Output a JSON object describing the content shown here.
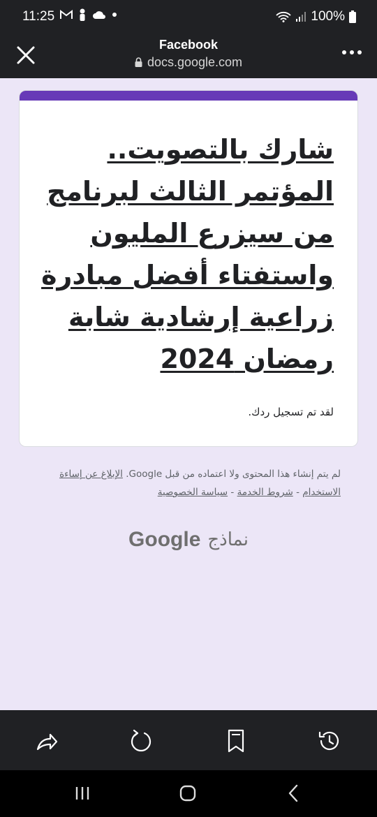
{
  "status_bar": {
    "time": "11:25",
    "battery": "100%",
    "notif_icons": [
      "gmail-icon",
      "person-icon",
      "cloud-icon",
      "dot-icon"
    ],
    "right_icons": [
      "wifi-icon",
      "signal-icon",
      "battery-icon"
    ]
  },
  "browser": {
    "title": "Facebook",
    "url": "docs.google.com"
  },
  "form": {
    "accent_color": "#673ab7",
    "title": "شارك بالتصويت.. المؤتمر الثالث لبرنامج من سيزرع المليون واستفتاء أفضل مبادرة زراعية إرشادية شابة رمضان 2024",
    "confirmation": "لقد تم تسجيل ردك."
  },
  "footer": {
    "disclaimer_text": "لم يتم إنشاء هذا المحتوى ولا اعتماده من قبل Google.",
    "report_link": "الإبلاغ عن إساءة الاستخدام",
    "terms_link": "شروط الخدمة",
    "privacy_link": "سياسة الخصوصية",
    "separator": "-",
    "brand_google": "Google",
    "brand_forms": "نماذج"
  },
  "bottom_toolbar": [
    "share-icon",
    "refresh-icon",
    "bookmark-icon",
    "history-icon"
  ],
  "nav_bar": [
    "recents-icon",
    "home-icon",
    "back-icon"
  ]
}
